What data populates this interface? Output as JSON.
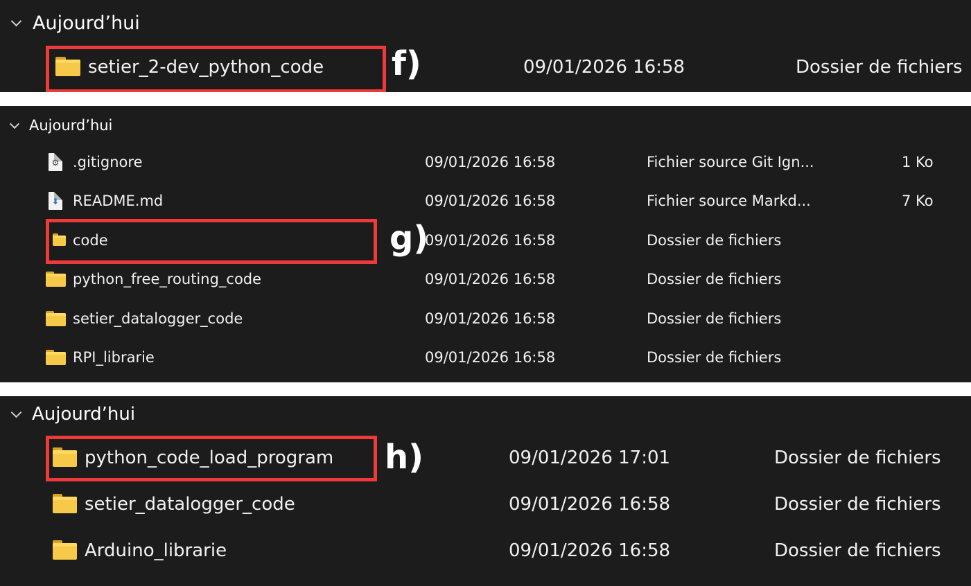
{
  "panel_f": {
    "group_label": "Aujourd’hui",
    "annotation": "f)",
    "rows": [
      {
        "name": "setier_2-dev_python_code",
        "date": "09/01/2026 16:58",
        "type": "Dossier de fichiers",
        "size": "",
        "icon": "folder-icon"
      }
    ]
  },
  "panel_g": {
    "group_label": "Aujourd’hui",
    "annotation": "g)",
    "rows": [
      {
        "name": ".gitignore",
        "date": "09/01/2026 16:58",
        "type": "Fichier source Git Ign...",
        "size": "1 Ko",
        "icon": "gear-file-icon"
      },
      {
        "name": "README.md",
        "date": "09/01/2026 16:58",
        "type": "Fichier source Markd...",
        "size": "7 Ko",
        "icon": "markdown-file-icon"
      },
      {
        "name": "code",
        "date": "09/01/2026 16:58",
        "type": "Dossier de fichiers",
        "size": "",
        "icon": "folder-icon"
      },
      {
        "name": "python_free_routing_code",
        "date": "09/01/2026 16:58",
        "type": "Dossier de fichiers",
        "size": "",
        "icon": "folder-icon"
      },
      {
        "name": "setier_datalogger_code",
        "date": "09/01/2026 16:58",
        "type": "Dossier de fichiers",
        "size": "",
        "icon": "folder-icon"
      },
      {
        "name": "RPI_librarie",
        "date": "09/01/2026 16:58",
        "type": "Dossier de fichiers",
        "size": "",
        "icon": "folder-icon"
      }
    ]
  },
  "panel_h": {
    "group_label": "Aujourd’hui",
    "annotation": "h)",
    "rows": [
      {
        "name": "python_code_load_program",
        "date": "09/01/2026 17:01",
        "type": "Dossier de fichiers",
        "size": "",
        "icon": "folder-icon"
      },
      {
        "name": "setier_datalogger_code",
        "date": "09/01/2026 16:58",
        "type": "Dossier de fichiers",
        "size": "",
        "icon": "folder-icon"
      },
      {
        "name": "Arduino_librarie",
        "date": "09/01/2026 16:58",
        "type": "Dossier de fichiers",
        "size": "",
        "icon": "folder-icon"
      }
    ]
  },
  "colors": {
    "panel_background": "#1c1c1c",
    "highlight_border": "#f03a3a",
    "folder_yellow": "#f7c948"
  }
}
